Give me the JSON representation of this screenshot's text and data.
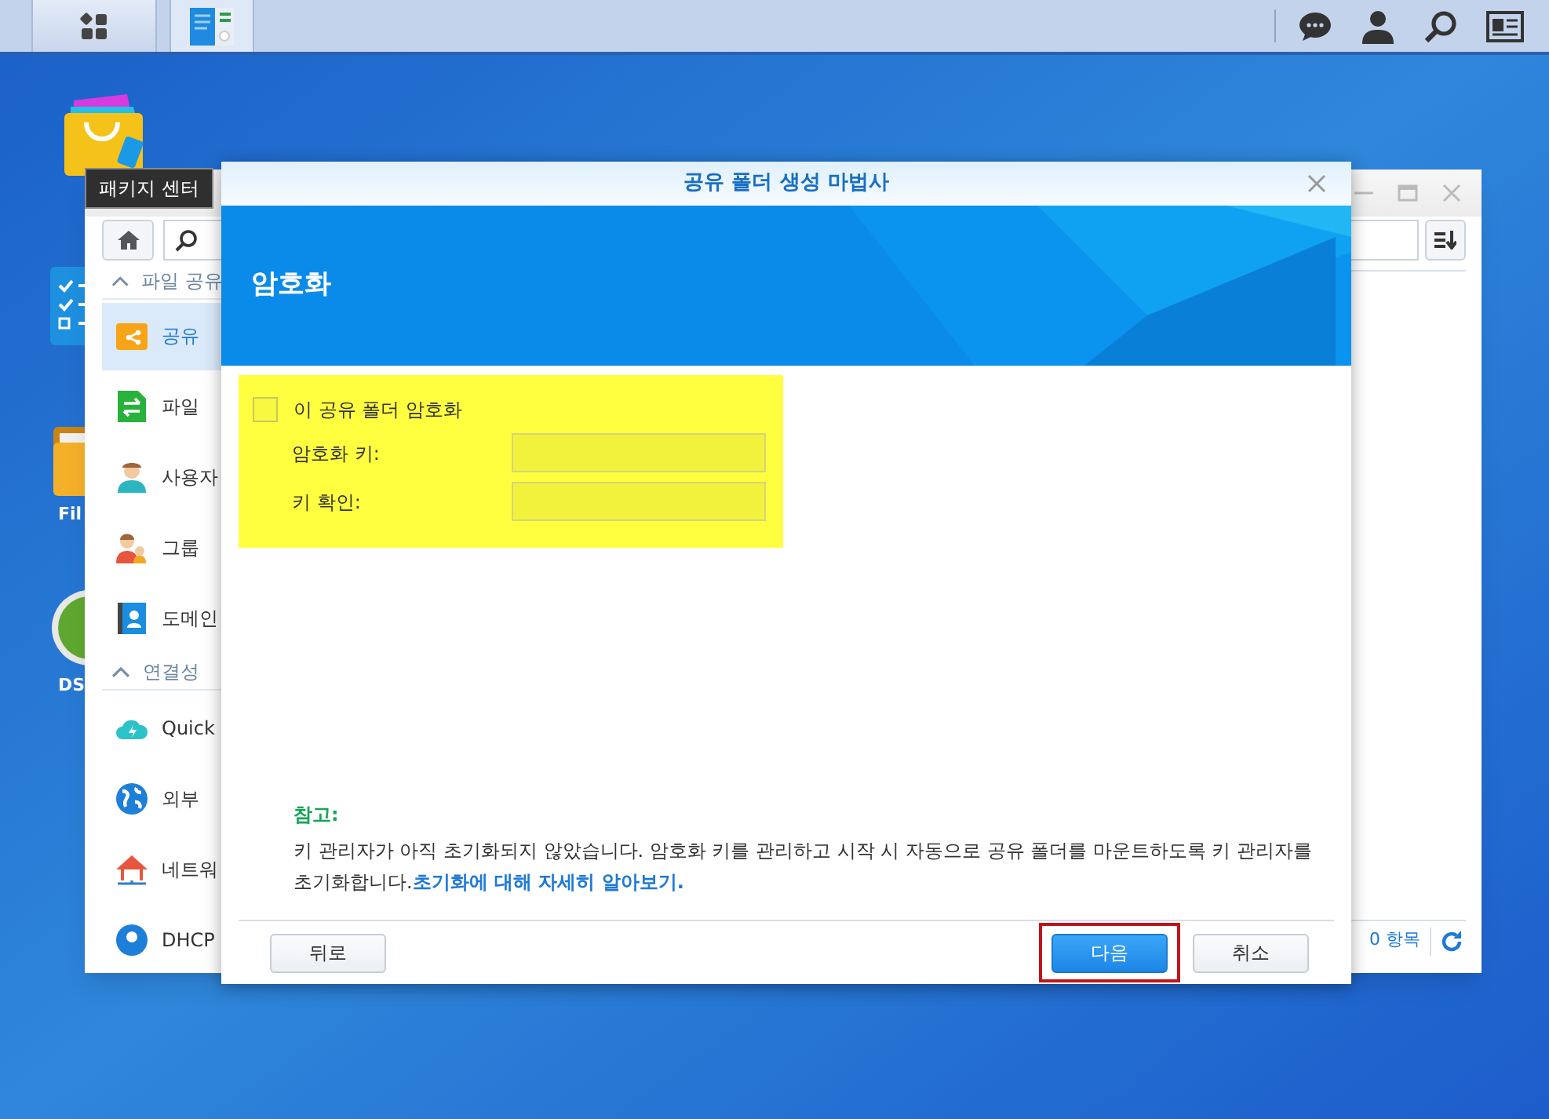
{
  "desktop": {
    "tooltip": "패키지 센터",
    "icons": [
      {
        "kind": "list"
      },
      {
        "kind": "folder",
        "label": "Fil"
      },
      {
        "kind": "disc",
        "label": "DS"
      }
    ]
  },
  "control_panel": {
    "sidebar": [
      {
        "kind": "section",
        "label": "파일 공유",
        "expanded": true
      },
      {
        "kind": "item",
        "label": "공유",
        "selected": true
      },
      {
        "kind": "item",
        "label": "파일",
        "selected": false
      },
      {
        "kind": "item",
        "label": "사용자",
        "selected": false
      },
      {
        "kind": "item",
        "label": "그룹",
        "selected": false
      },
      {
        "kind": "item",
        "label": "도메인",
        "selected": false
      },
      {
        "kind": "section",
        "label": "연결성",
        "expanded": true
      },
      {
        "kind": "item",
        "label": "Quick",
        "selected": false
      },
      {
        "kind": "item",
        "label": "외부",
        "selected": false
      },
      {
        "kind": "item",
        "label": "네트워",
        "selected": false
      },
      {
        "kind": "item",
        "label": "DHCP",
        "selected": false
      }
    ],
    "status": "0 항목"
  },
  "dialog": {
    "title": "공유 폴더 생성 마법사",
    "step_title": "암호화",
    "encrypt": {
      "label": "이 공유 폴더 암호화",
      "checked": false
    },
    "fields": [
      {
        "label": "암호화 키:"
      },
      {
        "label": "키 확인:"
      }
    ],
    "note": {
      "title": "참고:",
      "text": "키 관리자가 아직 초기화되지 않았습니다. 암호화 키를 관리하고 시작 시 자동으로 공유 폴더를 마운트하도록 키 관리자를 초기화합니다.",
      "link": "초기화에 대해 자세히 알아보기."
    },
    "buttons": [
      {
        "kind": "secondary",
        "label": "뒤로",
        "highlighted": false
      },
      {
        "kind": "primary",
        "label": "다음",
        "highlighted": true
      },
      {
        "kind": "secondary",
        "label": "취소",
        "highlighted": false
      }
    ]
  }
}
